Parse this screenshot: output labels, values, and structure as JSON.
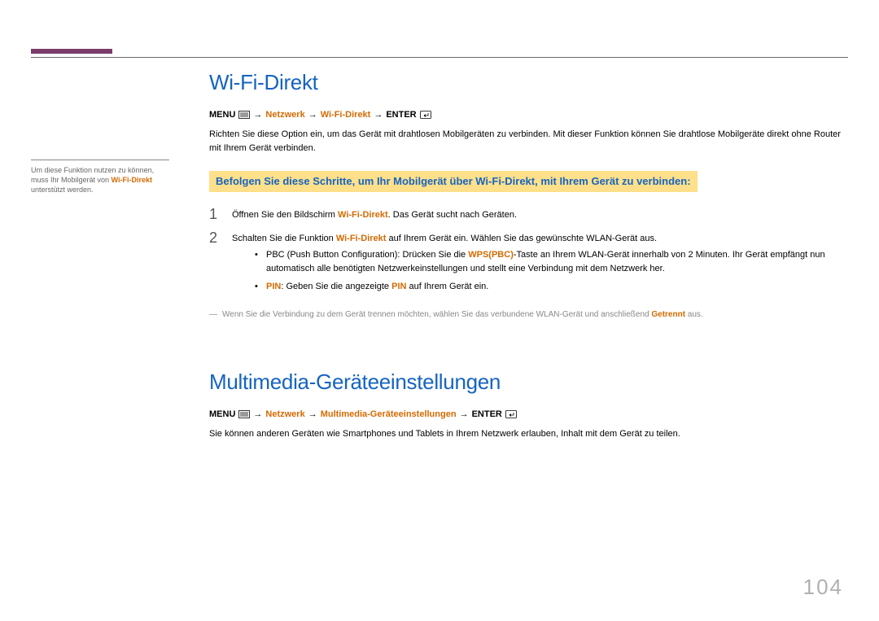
{
  "sidebar": {
    "note_pre": "Um diese Funktion nutzen zu können, muss Ihr Mobilgerät von ",
    "note_hl": "Wi-Fi-Direkt",
    "note_post": " unterstützt werden."
  },
  "section1": {
    "title": "Wi-Fi-Direkt",
    "nav": {
      "menu": "MENU",
      "arrow": "→",
      "p1": "Netzwerk",
      "p2": "Wi-Fi-Direkt",
      "enter": "ENTER"
    },
    "intro": "Richten Sie diese Option ein, um das Gerät mit drahtlosen Mobilgeräten zu verbinden. Mit dieser Funktion können Sie drahtlose Mobilgeräte direkt ohne Router mit Ihrem Gerät verbinden.",
    "band": "Befolgen Sie diese Schritte, um Ihr Mobilgerät über Wi-Fi-Direkt, mit Ihrem Gerät zu verbinden:",
    "step1": {
      "num": "1",
      "pre": "Öffnen Sie den Bildschirm ",
      "hl": "Wi-Fi-Direkt",
      "post": ". Das Gerät sucht nach Geräten."
    },
    "step2": {
      "num": "2",
      "pre": "Schalten Sie die Funktion ",
      "hl": "Wi-Fi-Direkt",
      "post": " auf Ihrem Gerät ein. Wählen Sie das gewünschte WLAN-Gerät aus."
    },
    "bullet1": {
      "pre": "PBC (Push Button Configuration): Drücken Sie die ",
      "hl": "WPS(PBC)",
      "post": "-Taste an Ihrem WLAN-Gerät innerhalb von 2 Minuten. Ihr Gerät empfängt nun automatisch alle benötigten Netzwerkeinstellungen und stellt eine Verbindung mit dem Netzwerk her."
    },
    "bullet2": {
      "hl1": "PIN",
      "mid": ": Geben Sie die angezeigte ",
      "hl2": "PIN",
      "post": " auf Ihrem Gerät ein."
    },
    "note": {
      "dash": "―",
      "pre": "Wenn Sie die Verbindung zu dem Gerät trennen möchten, wählen Sie das verbundene WLAN-Gerät und anschließend ",
      "hl": "Getrennt",
      "post": " aus."
    }
  },
  "section2": {
    "title": "Multimedia-Geräteeinstellungen",
    "nav": {
      "menu": "MENU",
      "arrow": "→",
      "p1": "Netzwerk",
      "p2": "Multimedia-Geräteeinstellungen",
      "enter": "ENTER"
    },
    "intro": "Sie können anderen Geräten wie Smartphones und Tablets in Ihrem Netzwerk erlauben, Inhalt mit dem Gerät zu teilen."
  },
  "page_number": "104"
}
